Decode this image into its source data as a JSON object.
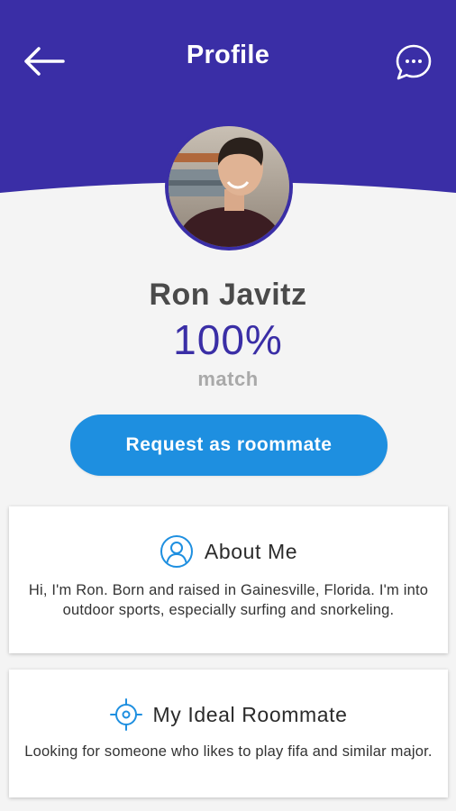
{
  "header": {
    "title": "Profile",
    "back_icon": "arrow-left-icon",
    "chat_icon": "chat-bubble-icon",
    "background_color": "#3a2ea6"
  },
  "profile": {
    "name": "Ron Javitz",
    "match_percent": "100%",
    "match_label": "match",
    "accent_color": "#3a2ea6"
  },
  "actions": {
    "request_label": "Request as roommate",
    "button_color": "#1e8fe0"
  },
  "about": {
    "title": "About Me",
    "icon": "user-circle-icon",
    "text": "Hi, I'm Ron. Born and raised in Gainesville, Florida. I'm into outdoor sports, especially surfing and snorkeling."
  },
  "ideal_roommate": {
    "title": "My Ideal Roommate",
    "icon": "target-icon",
    "text": "Looking for someone who likes to play fifa and similar major."
  }
}
